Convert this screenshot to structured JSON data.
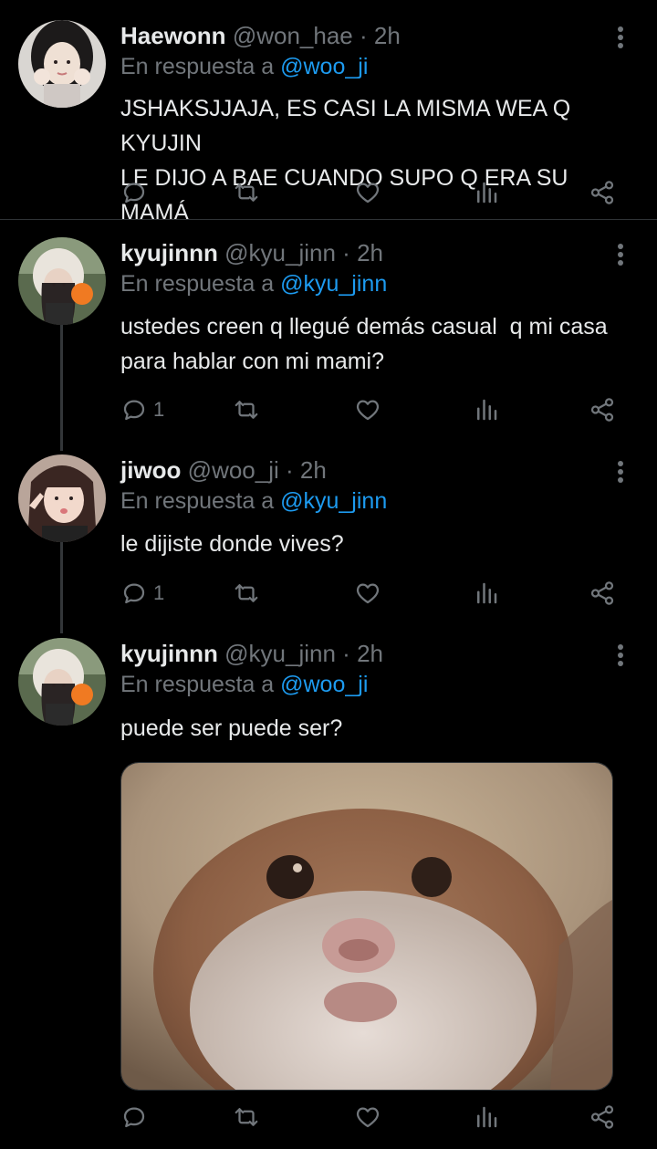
{
  "colors": {
    "background": "#000000",
    "text": "#e7e9ea",
    "muted": "#71767b",
    "mention": "#1d9bf0",
    "divider": "#2f3336"
  },
  "tweets": [
    {
      "name": "Haewonn",
      "handle": "@won_hae",
      "separator": "·",
      "time": "2h",
      "reply_prefix": "En respuesta a",
      "reply_mention": "@woo_ji",
      "text_lines": [
        "JSHAKSJJAJA, ES CASI LA MISMA WEA Q KYUJIN",
        "LE DIJO A BAE CUANDO SUPO Q ERA SU MAMÁ"
      ],
      "reply_count": ""
    },
    {
      "name": "kyujinnn",
      "handle": "@kyu_jinn",
      "separator": "·",
      "time": "2h",
      "reply_prefix": "En respuesta a",
      "reply_mention": "@kyu_jinn",
      "text_lines": [
        "ustedes creen q llegué demás casual  q mi casa",
        "para hablar con mi mami?"
      ],
      "reply_count": "1"
    },
    {
      "name": "jiwoo",
      "handle": "@woo_ji",
      "separator": "·",
      "time": "2h",
      "reply_prefix": "En respuesta a",
      "reply_mention": "@kyu_jinn",
      "text_lines": [
        "le dijiste donde vives?"
      ],
      "reply_count": "1"
    },
    {
      "name": "kyujinnn",
      "handle": "@kyu_jinn",
      "separator": "·",
      "time": "2h",
      "reply_prefix": "En respuesta a",
      "reply_mention": "@woo_ji",
      "text_lines": [
        "puede ser puede ser?"
      ],
      "reply_count": "",
      "media": "hamster-photo"
    }
  ],
  "icons": {
    "reply": "reply-icon",
    "retweet": "retweet-icon",
    "like": "heart-icon",
    "views": "views-icon",
    "share": "share-icon",
    "more": "more-icon"
  }
}
